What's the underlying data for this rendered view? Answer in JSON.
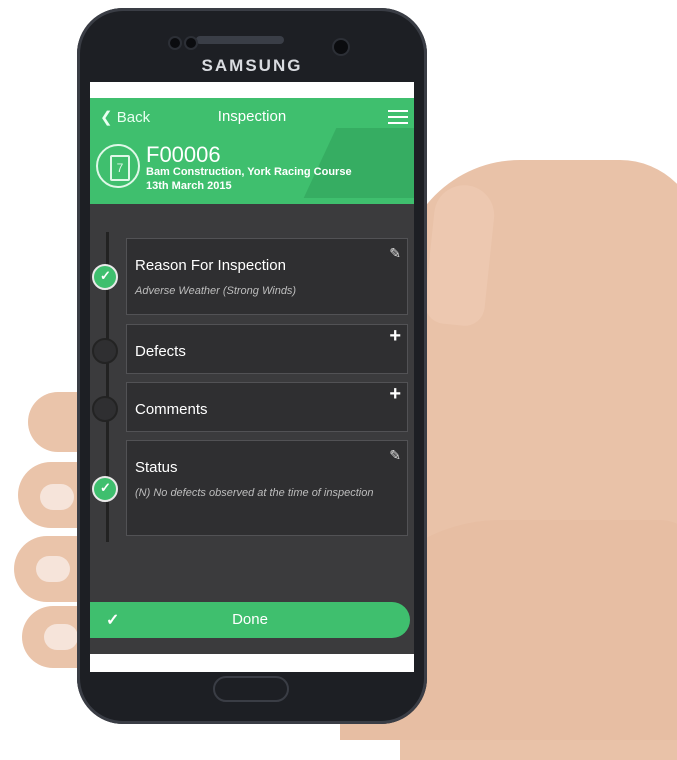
{
  "device": {
    "brand": "SAMSUNG"
  },
  "header": {
    "back_label": "Back",
    "title": "Inspection",
    "menu_icon": "hamburger-icon",
    "clipboard_number": "7",
    "code": "F00006",
    "site": "Bam Construction, York Racing Course",
    "date": "13th March 2015",
    "accent_color": "#3fbf6e"
  },
  "steps": [
    {
      "title": "Reason For Inspection",
      "subtitle": "Adverse Weather (Strong Winds)",
      "completed": true,
      "action_icon": "edit-icon"
    },
    {
      "title": "Defects",
      "subtitle": "",
      "completed": false,
      "action_icon": "plus-icon"
    },
    {
      "title": "Comments",
      "subtitle": "",
      "completed": false,
      "action_icon": "plus-icon"
    },
    {
      "title": "Status",
      "subtitle": "(N) No defects observed at the time of inspection",
      "completed": true,
      "action_icon": "edit-icon"
    }
  ],
  "done_button": {
    "label": "Done"
  }
}
